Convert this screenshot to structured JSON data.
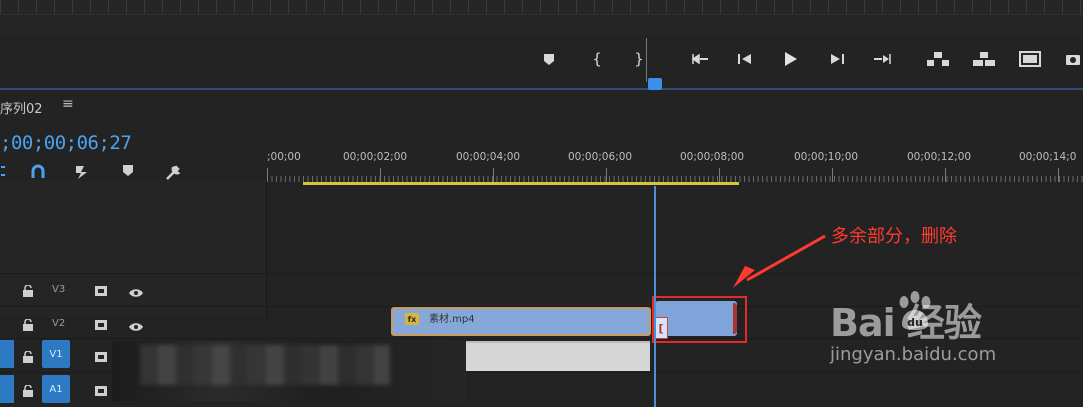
{
  "sequence": {
    "tab_label": "序列02",
    "menu_glyph": "≡",
    "timecode": ";00;00;06;27"
  },
  "ruler": {
    "labels": [
      ";00;00",
      "00;00;02;00",
      "00;00;04;00",
      "00;00;06;00",
      "00;00;08;00",
      "00;00;10;00",
      "00;00;12;00",
      "00;00;14;0"
    ]
  },
  "tracks": {
    "v3": "V3",
    "v2": "V2",
    "v1": "V1",
    "a1": "A1"
  },
  "clip": {
    "fx": "fx",
    "name": "素材.mp4"
  },
  "transport": {
    "mark_in": "{",
    "mark_out": "}"
  },
  "annotation": {
    "text": "多余部分，删除"
  },
  "watermark": {
    "brand": "Bai  经验",
    "url": "jingyan.baidu.com"
  },
  "colors": {
    "accent": "#4aa3f0",
    "annotation": "#ff3b30",
    "work_area": "#d8c53a"
  }
}
